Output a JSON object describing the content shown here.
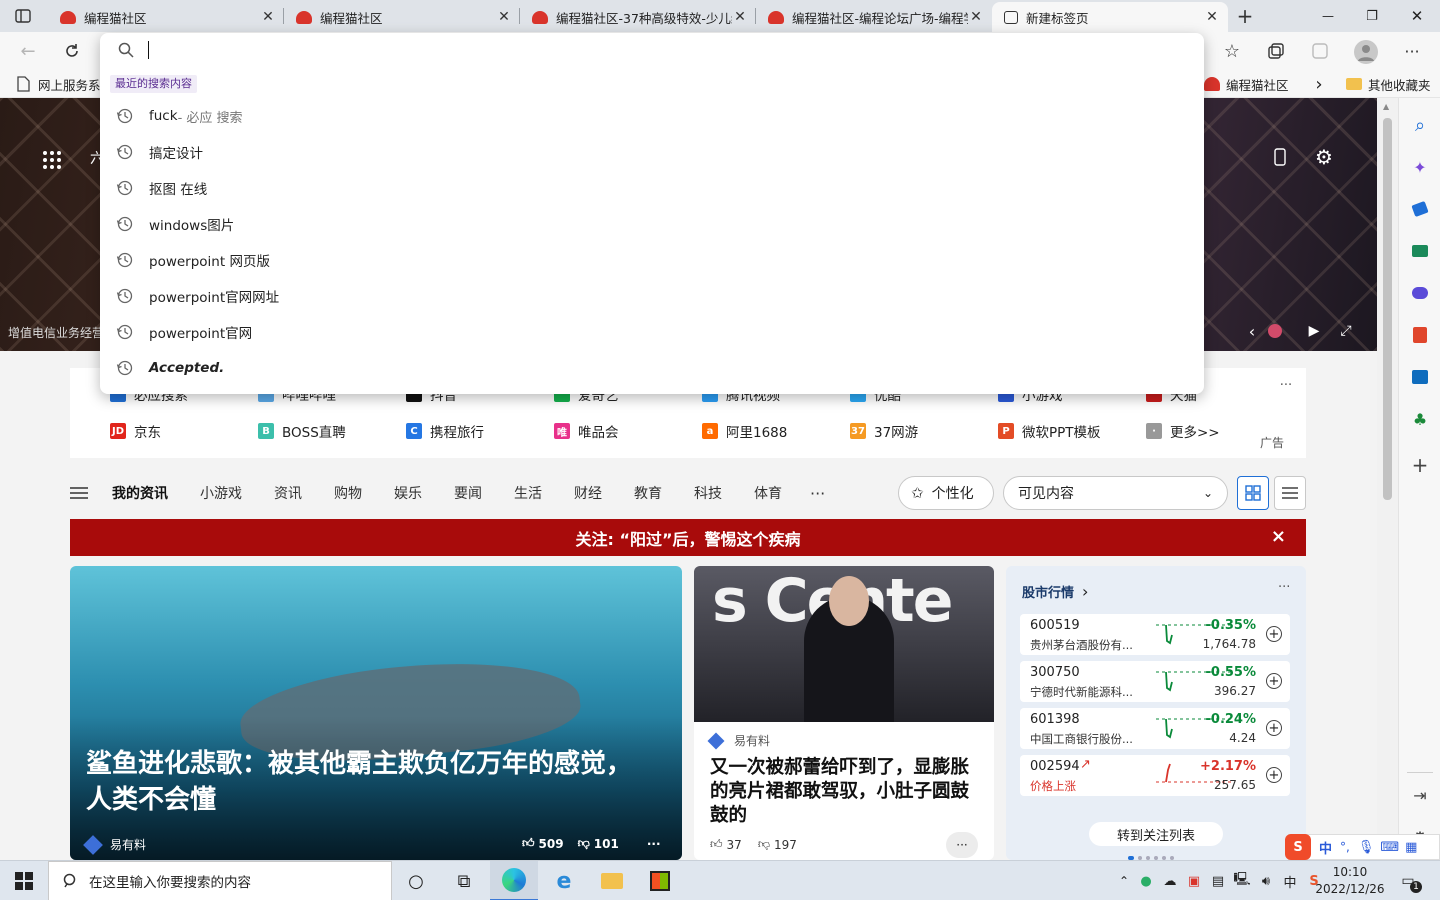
{
  "tabs": [
    {
      "title": "编程猫社区",
      "active": false
    },
    {
      "title": "编程猫社区",
      "active": false
    },
    {
      "title": "编程猫社区-37种高级特效-少儿编程",
      "active": false
    },
    {
      "title": "编程猫社区-编程论坛广场-编程学习",
      "active": false
    },
    {
      "title": "新建标签页",
      "active": true
    }
  ],
  "window_controls": {
    "new_tab": "+",
    "minimize": "—",
    "restore": "❐",
    "close": "✕"
  },
  "favorites": {
    "left_item": "网上服务系统",
    "right_item": "编程猫社区",
    "more": "›",
    "other": "其他收藏夹"
  },
  "omnibox": {
    "section_label": "最近的搜索内容",
    "suggestions": [
      {
        "text": "fuck",
        "hint": " - 必应 搜索",
        "italic": false
      },
      {
        "text": "搞定设计",
        "hint": "",
        "italic": false
      },
      {
        "text": "抠图 在线",
        "hint": "",
        "italic": false
      },
      {
        "text": "windows图片",
        "hint": "",
        "italic": false
      },
      {
        "text": "powerpoint 网页版",
        "hint": "",
        "italic": false
      },
      {
        "text": "powerpoint官网网址",
        "hint": "",
        "italic": false
      },
      {
        "text": "powerpoint官网",
        "hint": "",
        "italic": false
      },
      {
        "text": "Accepted.",
        "hint": "",
        "italic": true
      }
    ]
  },
  "hero": {
    "grid_label": "六",
    "footer_text": "增值电信业务经营许可证"
  },
  "quick_links": {
    "row1": [
      "必应搜索",
      "哔哩哔哩",
      "抖音",
      "爱奇艺",
      "腾讯视频",
      "优酷",
      "小游戏",
      "天猫"
    ],
    "row2": [
      {
        "label": "京东",
        "icon": "JD",
        "color": "#e1251b"
      },
      {
        "label": "BOSS直聘",
        "icon": "B",
        "color": "#3cbfab"
      },
      {
        "label": "携程旅行",
        "icon": "C",
        "color": "#2577e3"
      },
      {
        "label": "唯品会",
        "icon": "唯",
        "color": "#e8308a"
      },
      {
        "label": "阿里1688",
        "icon": "a",
        "color": "#ff6a00"
      },
      {
        "label": "37网游",
        "icon": "37",
        "color": "#f59a23"
      },
      {
        "label": "微软PPT模板",
        "icon": "P",
        "color": "#e34c26"
      },
      {
        "label": "更多>>",
        "icon": "·",
        "color": "#999999"
      }
    ],
    "more": "···",
    "ad": "广告"
  },
  "news_nav": {
    "items": [
      "我的资讯",
      "小游戏",
      "资讯",
      "购物",
      "娱乐",
      "要闻",
      "生活",
      "财经",
      "教育",
      "科技",
      "体育"
    ],
    "more": "···",
    "personalize": "个性化",
    "visible_content": "可见内容"
  },
  "banner": {
    "text": "关注: “阳过”后，警惕这个疾病",
    "close": "×"
  },
  "card1": {
    "title": "鲨鱼进化悲歌：被其他霸主欺负亿万年的感觉，人类不会懂",
    "source": "易有料",
    "likes": "509",
    "dislikes": "101",
    "more": "···"
  },
  "card2": {
    "image_text": "s Cente",
    "source": "易有料",
    "title": "又一次被郝蕾给吓到了，显膨胀的亮片裙都敢驾驭，小肚子圆鼓鼓的",
    "likes": "37",
    "dislikes": "197",
    "more": "···"
  },
  "stocks": {
    "title": "股市行情",
    "chev": "›",
    "more": "···",
    "items": [
      {
        "code": "600519",
        "name": "贵州茅台酒股份有...",
        "change": "-0.35%",
        "price": "1,764.78",
        "color": "#0a8a3a"
      },
      {
        "code": "300750",
        "name": "宁德时代新能源科...",
        "change": "-0.55%",
        "price": "396.27",
        "color": "#0a8a3a"
      },
      {
        "code": "601398",
        "name": "中国工商银行股份...",
        "change": "-0.24%",
        "price": "4.24",
        "color": "#0a8a3a"
      },
      {
        "code": "002594",
        "name": "价格上涨",
        "change": "+2.17%",
        "price": "257.65",
        "color": "#d9342b"
      }
    ],
    "follow_button": "转到关注列表"
  },
  "taskbar": {
    "search_placeholder": "在这里输入你要搜索的内容",
    "ime": "中",
    "time": "10:10",
    "date": "2022/12/26",
    "notifications": "1"
  }
}
